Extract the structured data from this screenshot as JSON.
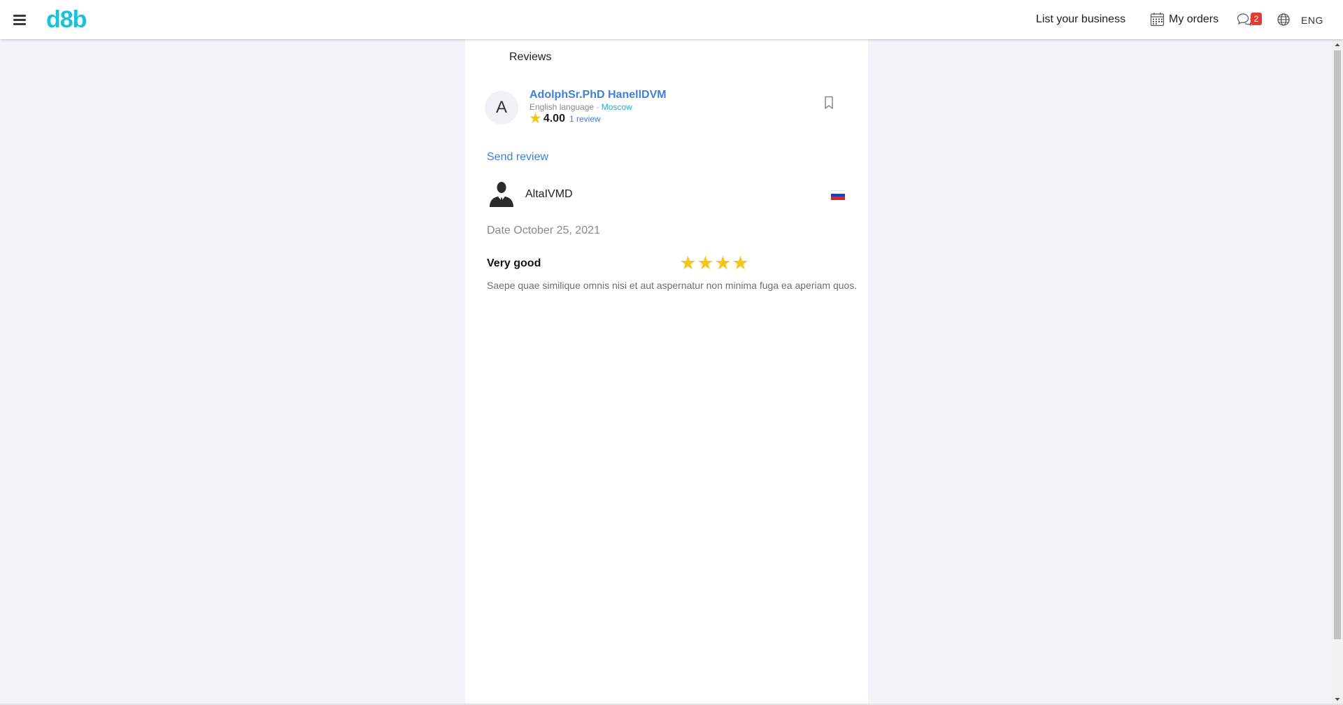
{
  "header": {
    "logo": "d8b",
    "nav": {
      "list_business": "List your business",
      "my_orders": "My orders",
      "messages_badge": "2",
      "language": "ENG"
    },
    "icons": {
      "menu": "hamburger-menu-icon",
      "orders": "calendar-icon",
      "messages": "chat-bubbles-icon",
      "language": "globe-icon"
    }
  },
  "page": {
    "tab_label": "Reviews",
    "master": {
      "avatar_letter": "A",
      "name": "AdolphSr.PhD HanellDVM",
      "language": "English language",
      "separator": "·",
      "city": "Moscow",
      "rating": "4.00",
      "reviews_link": "1 review"
    },
    "send_review_label": "Send review",
    "review": {
      "author": "AltaIVMD",
      "country_flag": "russia-flag-icon",
      "date": "Date October 25, 2021",
      "title": "Very good",
      "stars": 4,
      "text": "Saepe quae similique omnis nisi et aut aspernatur non minima fuga ea aperiam quos."
    }
  },
  "colors": {
    "brand": "#18c3d9",
    "link": "#3d82d6",
    "star": "#f5c518",
    "badge": "#e53935",
    "background": "#f3f4f8"
  }
}
